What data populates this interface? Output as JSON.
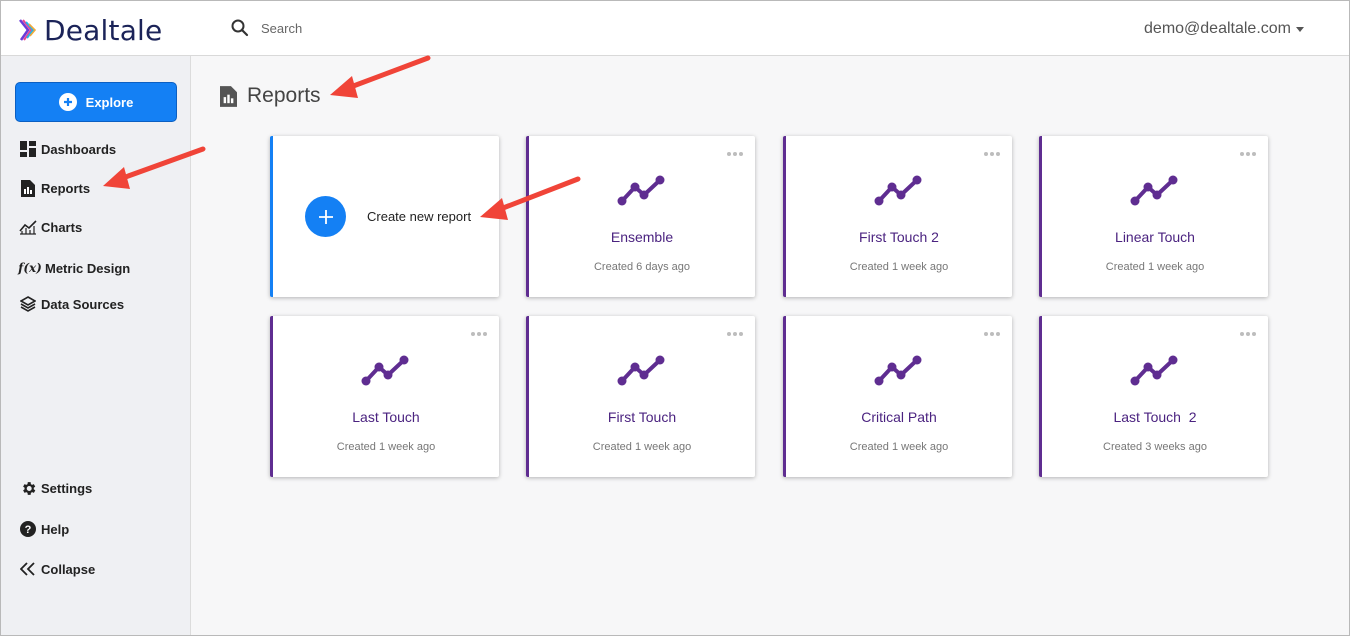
{
  "app": {
    "logo_text": "Dealtale",
    "search_placeholder": "Search",
    "user_email": "demo@dealtale.com"
  },
  "sidebar": {
    "explore_label": "Explore",
    "items": [
      {
        "label": "Dashboards",
        "icon": "dashboard-icon"
      },
      {
        "label": "Reports",
        "icon": "report-icon"
      },
      {
        "label": "Charts",
        "icon": "line-chart-icon"
      },
      {
        "label": "Metric Design",
        "icon": "function-icon"
      },
      {
        "label": "Data Sources",
        "icon": "layers-icon"
      }
    ],
    "bottom_items": [
      {
        "label": "Settings",
        "icon": "gear-icon"
      },
      {
        "label": "Help",
        "icon": "help-icon"
      },
      {
        "label": "Collapse",
        "icon": "double-chevron-left-icon"
      }
    ]
  },
  "main": {
    "page_title": "Reports",
    "create_label": "Create new report",
    "reports": [
      {
        "name": "Ensemble",
        "created": "Created 6 days ago"
      },
      {
        "name": "First Touch 2",
        "created": "Created 1 week ago"
      },
      {
        "name": "Linear Touch",
        "created": "Created 1 week ago"
      },
      {
        "name": "Last Touch",
        "created": "Created 1 week ago"
      },
      {
        "name": "First Touch",
        "created": "Created 1 week ago"
      },
      {
        "name": "Critical Path",
        "created": "Created 1 week ago"
      },
      {
        "name": "Last Touch  2",
        "created": "Created 3 weeks ago"
      }
    ]
  },
  "colors": {
    "accent_blue": "#1480f4",
    "report_purple": "#5f2d91",
    "annotation_arrow": "#f04438"
  }
}
